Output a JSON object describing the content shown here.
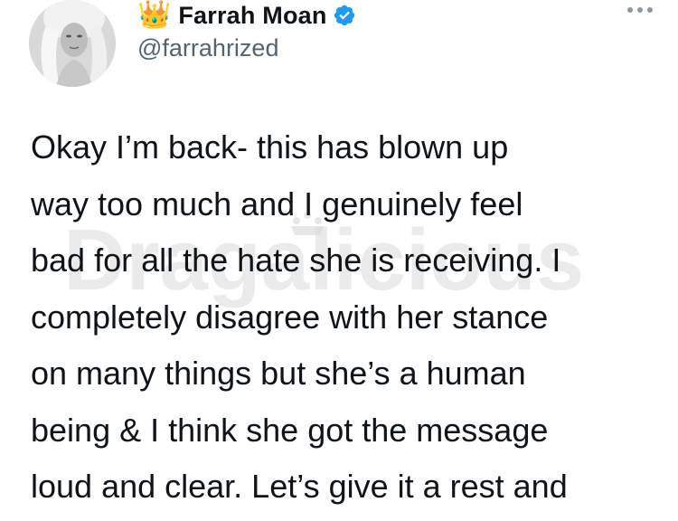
{
  "author": {
    "emoji": "👑",
    "display_name": "Farrah Moan",
    "handle": "@farrahrized",
    "avatar_icon": "profile-photo",
    "verified_icon": "verified-badge-icon",
    "verified_color": "#1d9bf0"
  },
  "menu": {
    "icon": "more-options-icon"
  },
  "tweet": {
    "lines": [
      "Okay I’m back- this has blown up",
      "way too much and I genuinely feel",
      "bad for all the hate she is receiving. I",
      "completely disagree with her stance",
      "on many things but she’s a human",
      "being & I think she got the message",
      "loud and clear. Let’s give it a rest and"
    ]
  },
  "watermark": {
    "text": "Dragalicious",
    "icon": "crown-watermark-icon"
  }
}
